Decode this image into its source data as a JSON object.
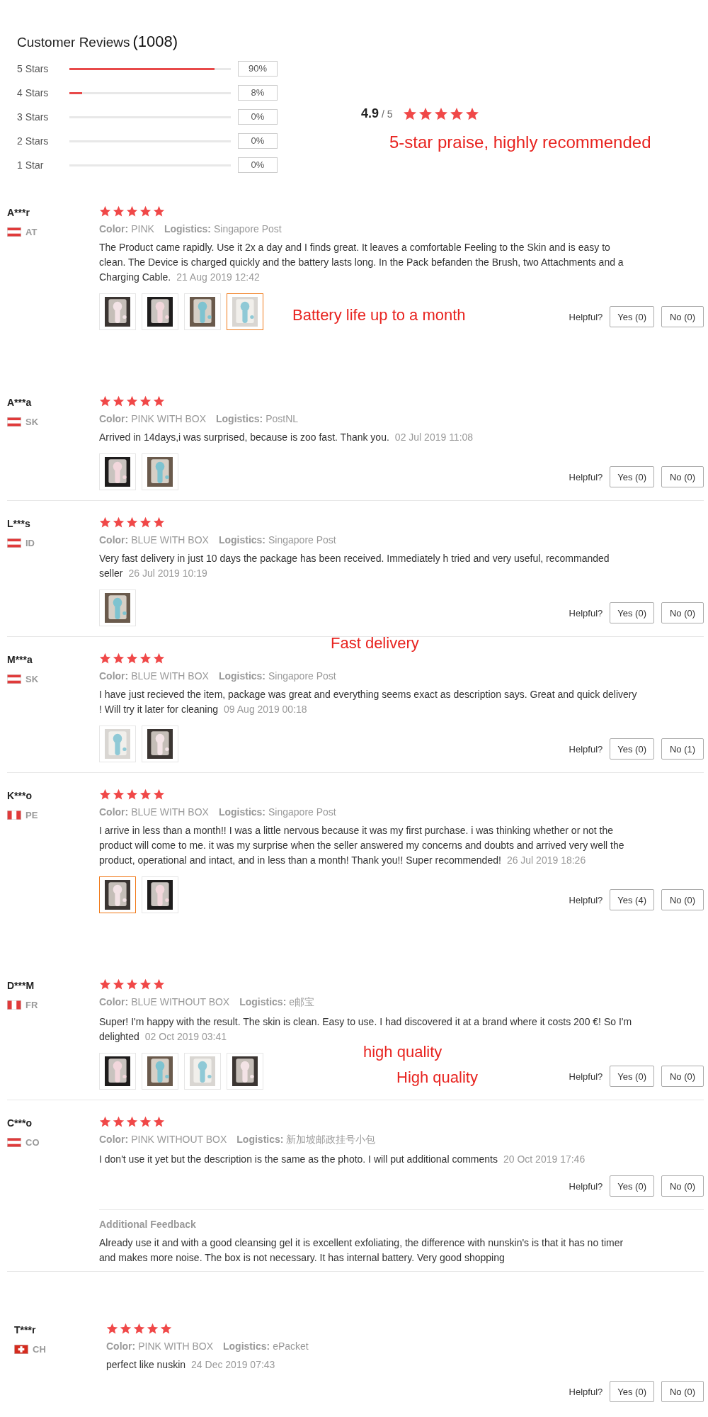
{
  "summary": {
    "title": "Customer Reviews",
    "count": "(1008)",
    "rows": [
      {
        "label": "5 Stars",
        "level": 0.9,
        "percent": "90%"
      },
      {
        "label": "4 Stars",
        "level": 0.08,
        "percent": "8%"
      },
      {
        "label": "3 Stars",
        "percent": "0%"
      },
      {
        "label": "2 Stars",
        "percent": "0%"
      },
      {
        "label": "1 Star",
        "percent": "0%"
      }
    ],
    "score": "4.9",
    "out_of": "/ 5",
    "stars": 5,
    "praise": "5-star praise, highly recommended"
  },
  "reviews": [
    {
      "name": "A***r",
      "country": "AT",
      "flag": {
        "kind": "h"
      },
      "stars": 5,
      "color_label": "Color:",
      "variant": "PINK",
      "logistics_label": "Logistics:",
      "logistics": "Singapore Post",
      "text": "The Product came rapidly. Use it 2x a day and I finds great. It leaves a comfortable Feeling to the Skin and is easy to clean. The Device is charged quickly and the battery lasts long. In the Pack befanden the Brush, two Attachments and a Charging Cable.",
      "date": "21 Aug 2019 12:42",
      "photos": [
        {
          "selected": false
        },
        {
          "selected": false
        },
        {
          "selected": false
        },
        {
          "selected": true
        }
      ],
      "helpful_label": "Helpful?",
      "yes": "Yes (0)",
      "no": "No (0)"
    },
    {
      "name": "A***a",
      "country": "SK",
      "flag": {
        "kind": "h"
      },
      "stars": 5,
      "color_label": "Color:",
      "variant": "PINK WITH BOX",
      "logistics_label": "Logistics:",
      "logistics": "PostNL",
      "text": "Arrived in 14days,i was surprised, because is zoo fast. Thank you.",
      "date": "02 Jul 2019 11:08",
      "photos": [
        {
          "selected": false
        },
        {
          "selected": false
        }
      ],
      "helpful_label": "Helpful?",
      "yes": "Yes (0)",
      "no": "No (0)"
    },
    {
      "name": "L***s",
      "country": "ID",
      "flag": {
        "kind": "h"
      },
      "stars": 5,
      "color_label": "Color:",
      "variant": "BLUE WITH BOX",
      "logistics_label": "Logistics:",
      "logistics": "Singapore Post",
      "text": "Very fast delivery in just 10 days the package has been received. Immediately h tried and very useful, recommanded seller",
      "date": "26 Jul 2019 10:19",
      "photos": [
        {
          "selected": false
        }
      ],
      "helpful_label": "Helpful?",
      "yes": "Yes (0)",
      "no": "No (0)"
    },
    {
      "name": "M***a",
      "country": "SK",
      "flag": {
        "kind": "h"
      },
      "stars": 5,
      "color_label": "Color:",
      "variant": "BLUE WITH BOX",
      "logistics_label": "Logistics:",
      "logistics": "Singapore Post",
      "text": "I have just recieved the item, package was great and everything seems exact as description says. Great and quick delivery ! Will try it later for cleaning",
      "date": "09 Aug 2019 00:18",
      "photos": [
        {
          "selected": false
        },
        {
          "selected": false
        }
      ],
      "helpful_label": "Helpful?",
      "yes": "Yes (0)",
      "no": "No (1)"
    },
    {
      "name": "K***o",
      "country": "PE",
      "flag": {
        "kind": "v"
      },
      "stars": 5,
      "color_label": "Color:",
      "variant": "BLUE WITH BOX",
      "logistics_label": "Logistics:",
      "logistics": "Singapore Post",
      "text": "I arrive in less than a month!! I was a little nervous because it was my first purchase. i was thinking whether or not the product will come to me. it was my surprise when the seller answered my concerns and doubts and arrived very well the product, operational and intact, and in less than a month! Thank you!! Super recommended!",
      "date": "26 Jul 2019 18:26",
      "photos": [
        {
          "selected": true
        },
        {
          "selected": false
        }
      ],
      "helpful_label": "Helpful?",
      "yes": "Yes (4)",
      "no": "No (0)"
    },
    {
      "name": "D***M",
      "country": "FR",
      "flag": {
        "kind": "v"
      },
      "stars": 5,
      "color_label": "Color:",
      "variant": "BLUE WITHOUT BOX",
      "logistics_label": "Logistics:",
      "logistics": "e邮宝",
      "text": "Super! I'm happy with the result. The skin is clean. Easy to use. I had discovered it at a brand where it costs 200 €! So I'm delighted",
      "date": "02 Oct 2019 03:41",
      "photos": [
        {
          "selected": false
        },
        {
          "selected": false
        },
        {
          "selected": false
        },
        {
          "selected": false
        }
      ],
      "helpful_label": "Helpful?",
      "yes": "Yes (0)",
      "no": "No (0)"
    },
    {
      "name": "C***o",
      "country": "CO",
      "flag": {
        "kind": "h"
      },
      "stars": 5,
      "color_label": "Color:",
      "variant": "PINK WITHOUT BOX",
      "logistics_label": "Logistics:",
      "logistics": "新加坡邮政挂号小包",
      "text": "I don't use it yet but the description is the same as the photo. I will put additional comments",
      "date": "20 Oct 2019 17:46",
      "helpful_label": "Helpful?",
      "yes": "Yes (0)",
      "no": "No (0)",
      "additional": {
        "title": "Additional Feedback",
        "text": "Already use it and with a good cleansing gel it is excellent exfoliating, the difference with nunskin's is that it has no timer and makes more noise. The box is not necessary. It has internal battery. Very good shopping"
      }
    },
    {
      "name": "T***r",
      "country": "CH",
      "flag": {
        "kind": "cross"
      },
      "stars": 5,
      "color_label": "Color:",
      "variant": "PINK WITH BOX",
      "logistics_label": "Logistics:",
      "logistics": "ePacket",
      "text": "perfect like nuskin",
      "date": "24 Dec 2019 07:43",
      "helpful_label": "Helpful?",
      "yes": "Yes (0)",
      "no": "No (0)"
    }
  ],
  "annotations": [
    "Battery life up to a month",
    "Fast delivery",
    "high quality",
    "High quality"
  ]
}
